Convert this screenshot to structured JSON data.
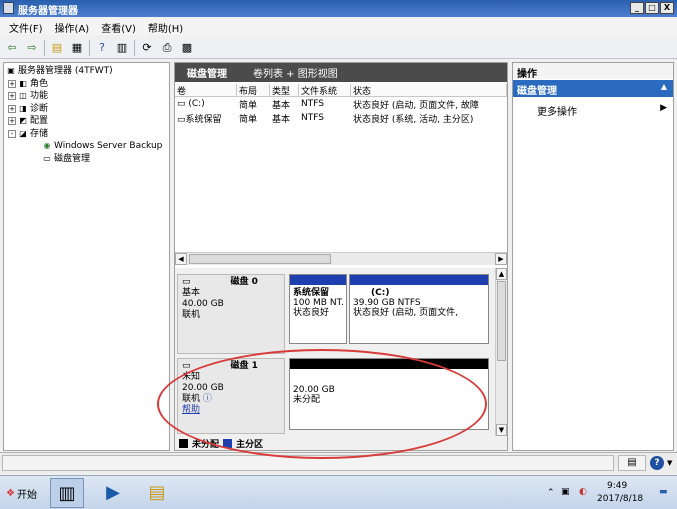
{
  "window": {
    "title": "服务器管理器",
    "min": "_",
    "max": "□",
    "close": "X"
  },
  "menu": [
    "文件(F)",
    "操作(A)",
    "查看(V)",
    "帮助(H)"
  ],
  "tree": [
    {
      "label": "服务器管理器 (4TFWT)",
      "indent": 0,
      "exp": ""
    },
    {
      "label": "角色",
      "indent": 1,
      "exp": "+"
    },
    {
      "label": "功能",
      "indent": 1,
      "exp": "+"
    },
    {
      "label": "诊断",
      "indent": 1,
      "exp": "+"
    },
    {
      "label": "配置",
      "indent": 1,
      "exp": "+"
    },
    {
      "label": "存储",
      "indent": 1,
      "exp": "-"
    },
    {
      "label": "Windows Server Backup",
      "indent": 2,
      "exp": ""
    },
    {
      "label": "磁盘管理",
      "indent": 2,
      "exp": ""
    }
  ],
  "center": {
    "header": {
      "title": "磁盘管理",
      "subtitle": "卷列表 + 图形视图"
    },
    "columns": [
      "卷",
      "布局",
      "类型",
      "文件系统",
      "状态"
    ],
    "rows": [
      {
        "vol": "(C:)",
        "layout": "简单",
        "type": "基本",
        "fs": "NTFS",
        "status": "状态良好 (启动, 页面文件, 故障"
      },
      {
        "vol": "系统保留",
        "layout": "简单",
        "type": "基本",
        "fs": "NTFS",
        "status": "状态良好 (系统, 活动, 主分区)"
      }
    ],
    "disk0": {
      "name": "磁盘 0",
      "type": "基本",
      "size": "40.00 GB",
      "state": "联机",
      "p1": {
        "name": "系统保留",
        "size": "100 MB NT.",
        "status": "状态良好"
      },
      "p2": {
        "name": "(C:)",
        "size": "39.90 GB NTFS",
        "status": "状态良好 (启动, 页面文件,"
      }
    },
    "disk1": {
      "name": "磁盘 1",
      "type": "未知",
      "size": "20.00 GB",
      "state": "联机",
      "help": "帮助",
      "p1": {
        "size": "20.00 GB",
        "status": "未分配"
      }
    },
    "legend": {
      "unallocated": "未分配",
      "primary": "主分区"
    }
  },
  "actions": {
    "header": "操作",
    "selected": "磁盘管理",
    "more": "更多操作"
  },
  "taskbar": {
    "start": "开始",
    "time": "9:49",
    "date": "2017/8/18"
  },
  "colors": {
    "primary": "#1f3fae",
    "unallocated": "#000000",
    "selection": "#2a6bc0"
  }
}
